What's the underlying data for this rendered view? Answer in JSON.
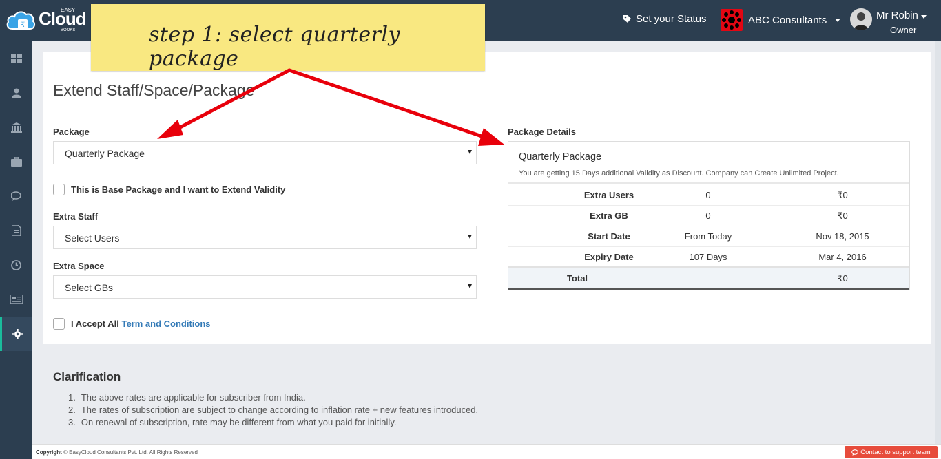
{
  "header": {
    "logo": {
      "brand": "Cloud",
      "easy": "EASY",
      "books": "BOOKS"
    },
    "status_label": "Set your Status",
    "company_name": "ABC Consultants",
    "user_name": "Mr Robin",
    "user_role": "Owner"
  },
  "sidebar": {
    "items": [
      {
        "icon": "dashboard-icon"
      },
      {
        "icon": "user-icon"
      },
      {
        "icon": "bank-icon"
      },
      {
        "icon": "briefcase-icon"
      },
      {
        "icon": "chat-icon"
      },
      {
        "icon": "document-icon"
      },
      {
        "icon": "clock-icon"
      },
      {
        "icon": "newspaper-icon"
      },
      {
        "icon": "gear-icon",
        "active": true
      }
    ]
  },
  "page": {
    "title": "Extend Staff/Space/Package"
  },
  "form": {
    "package_label": "Package",
    "package_value": "Quarterly Package",
    "base_package_checkbox": "This is Base Package and I want to Extend Validity",
    "extra_staff_label": "Extra Staff",
    "extra_staff_value": "Select Users",
    "extra_space_label": "Extra Space",
    "extra_space_value": "Select GBs",
    "accept_prefix": "I Accept All",
    "accept_link": "Term and Conditions"
  },
  "details": {
    "heading": "Package Details",
    "package_name": "Quarterly Package",
    "description": "You are getting 15 Days additional Validity as Discount. Company can Create Unlimited Project.",
    "rows": [
      {
        "label": "Extra Users",
        "value": "0",
        "amount": "₹0"
      },
      {
        "label": "Extra GB",
        "value": "0",
        "amount": "₹0"
      },
      {
        "label": "Start Date",
        "value": "From Today",
        "amount": "Nov 18, 2015"
      },
      {
        "label": "Expiry Date",
        "value": "107 Days",
        "amount": "Mar 4, 2016"
      }
    ],
    "total_label": "Total",
    "total_amount": "₹0"
  },
  "clarification": {
    "title": "Clarification",
    "items": [
      {
        "num": "1.",
        "text": "The above rates are applicable for subscriber from India."
      },
      {
        "num": "2.",
        "text": "The rates of subscription are subject to change according to inflation rate + new features introduced."
      },
      {
        "num": "3.",
        "text": "On renewal of subscription, rate may be different from what you paid for initially."
      }
    ]
  },
  "footer": {
    "copyright_bold": "Copyright",
    "copyright_text": "© EasyCloud Consultants Pvt. Ltd. All Rights Reserved",
    "support_button": "Contact to support team"
  },
  "annotation": {
    "note_text": "step 1: select quarterly package",
    "arrow_color": "#e8000b",
    "note_color": "#f9e881"
  }
}
